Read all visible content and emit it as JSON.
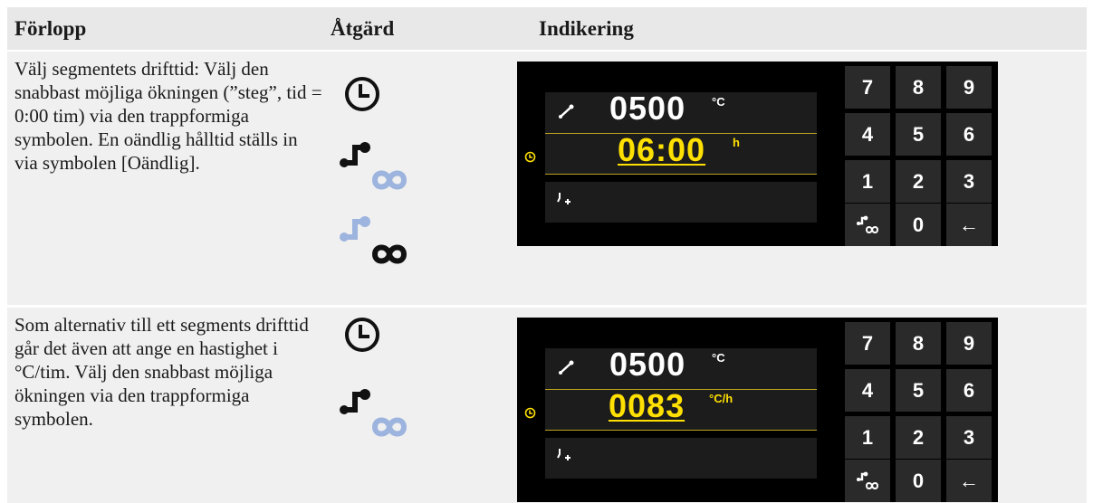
{
  "header": {
    "col1": "Förlopp",
    "col2": "Åtgärd",
    "col3": "Indikering"
  },
  "rows": [
    {
      "text": "Välj segmentets drifttid: Välj den snabbast möjliga ökningen (”steg”, tid = 0:00 tim) via den trappformiga symbolen. En oändlig hålltid ställs in via symbolen [Oändlig].",
      "display": {
        "temp": "0500",
        "temp_unit": "°C",
        "value": "06:00",
        "value_unit": "h"
      }
    },
    {
      "text": "Som alternativ till ett segments drifttid går det även att ange en hastighet i °C/tim. Välj den snabbast möjliga ökningen via den trappformiga symbolen.",
      "display": {
        "temp": "0500",
        "temp_unit": "°C",
        "value": "0083",
        "value_unit": "°C/h"
      }
    }
  ],
  "keypad": [
    "7",
    "8",
    "9",
    "4",
    "5",
    "6",
    "1",
    "2",
    "3",
    "step-infinity-icon",
    "0",
    "backspace-arrow-icon"
  ],
  "keypad_labels": {
    "k7": "7",
    "k8": "8",
    "k9": "9",
    "k4": "4",
    "k5": "5",
    "k6": "6",
    "k1": "1",
    "k2": "2",
    "k3": "3",
    "k0": "0",
    "back": "←"
  },
  "colors": {
    "accent_yellow": "#ffe000",
    "icon_blue": "#9db4df",
    "display_bg": "#000000"
  }
}
